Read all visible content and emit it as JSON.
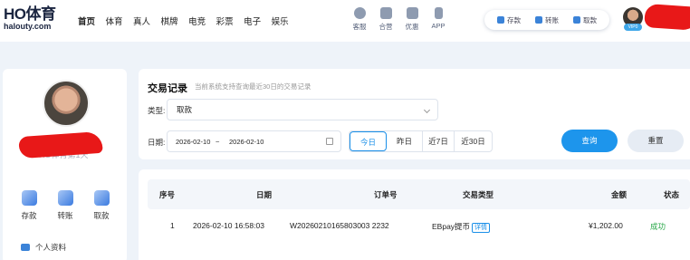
{
  "header": {
    "logo_main": "HO体育",
    "logo_sub": "halouty.com",
    "nav": [
      "首页",
      "体育",
      "真人",
      "棋牌",
      "电竞",
      "彩票",
      "电子",
      "娱乐"
    ],
    "services": [
      {
        "label": "客服",
        "icon": "customer-service-icon"
      },
      {
        "label": "合营",
        "icon": "partnership-icon"
      },
      {
        "label": "优惠",
        "icon": "promotion-icon"
      },
      {
        "label": "APP",
        "icon": "app-phone-icon"
      }
    ],
    "wallet_actions": [
      {
        "label": "存款",
        "icon": "deposit-icon"
      },
      {
        "label": "转账",
        "icon": "transfer-icon"
      },
      {
        "label": "取款",
        "icon": "withdraw-icon"
      }
    ],
    "vip_label": "VIP0"
  },
  "sidebar": {
    "username": "HO体育第1天",
    "quick_actions": [
      {
        "label": "存款",
        "icon": "deposit-icon"
      },
      {
        "label": "转账",
        "icon": "transfer-icon"
      },
      {
        "label": "取款",
        "icon": "withdraw-icon"
      }
    ],
    "profile_label": "个人资料"
  },
  "records": {
    "title": "交易记录",
    "subtitle": "当前系统支持查询最近30日的交易记录",
    "type_label": "类型:",
    "type_value": "取款",
    "date_label": "日期:",
    "date_start": "2026-02-10",
    "date_sep": "~",
    "date_end": "2026-02-10",
    "ranges": [
      "今日",
      "昨日",
      "近7日",
      "近30日"
    ],
    "active_range": "今日",
    "query_label": "查询",
    "reset_label": "重置"
  },
  "table": {
    "columns": [
      "序号",
      "日期",
      "订单号",
      "交易类型",
      "金额",
      "状态"
    ],
    "rows": [
      {
        "index": "1",
        "date": "2026-02-10 16:58:03",
        "order": "W20260210165803003 2232",
        "type": "EBpay提币",
        "detail": "详情",
        "amount": "¥1,202.00",
        "status": "成功"
      }
    ]
  },
  "colors": {
    "accent": "#1d95ec",
    "success": "#2aa84a",
    "background": "#eef3f9"
  }
}
